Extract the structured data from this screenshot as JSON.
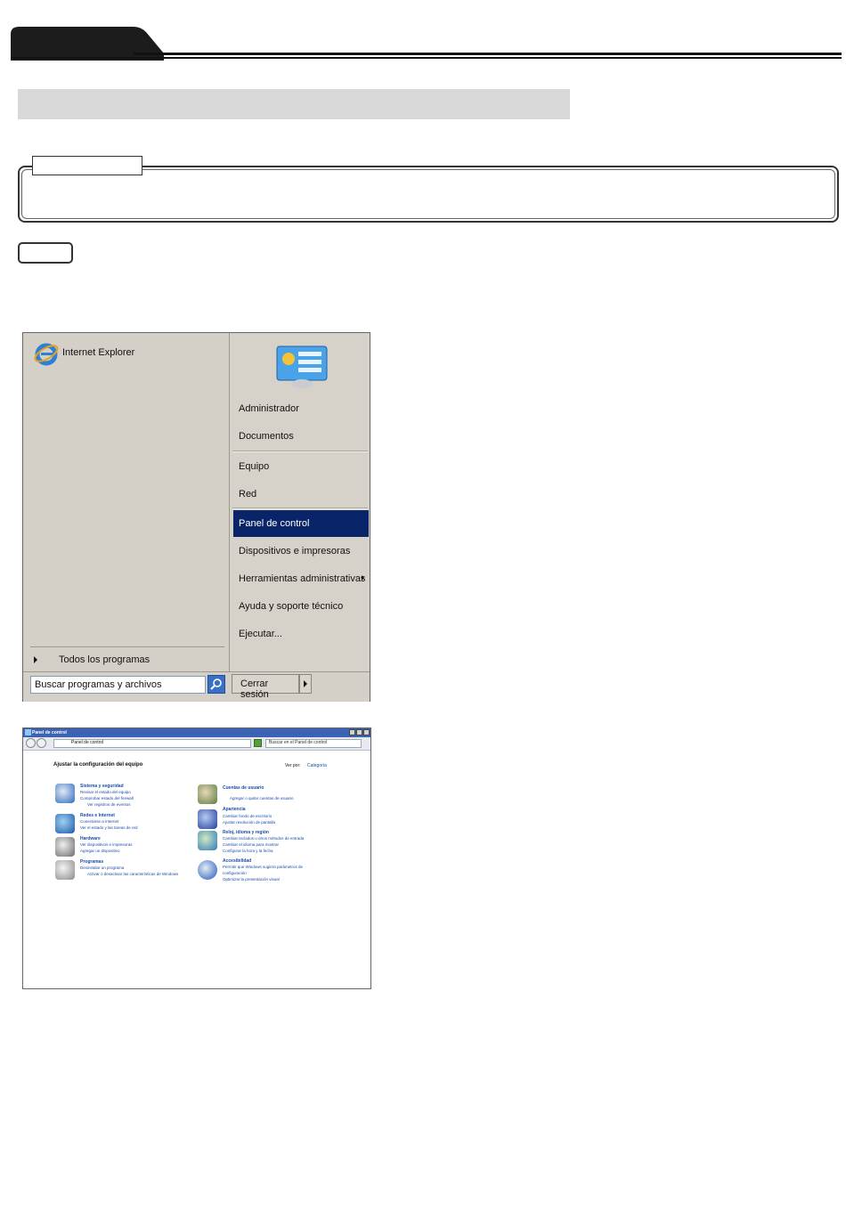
{
  "start_menu": {
    "pinned": [
      {
        "label": "Internet Explorer",
        "icon": "internet-explorer-icon"
      }
    ],
    "right_items": [
      {
        "label": "Administrador"
      },
      {
        "label": "Documentos"
      },
      {
        "label": "Equipo"
      },
      {
        "label": "Red"
      },
      {
        "label": "Panel de control",
        "selected": true
      },
      {
        "label": "Dispositivos e impresoras"
      },
      {
        "label": "Herramientas administrativas",
        "has_submenu": true
      },
      {
        "label": "Ayuda y soporte técnico"
      },
      {
        "label": "Ejecutar..."
      }
    ],
    "all_programs": "Todos los programas",
    "search_placeholder": "Buscar programas y archivos",
    "logoff": "Cerrar sesión",
    "colors": {
      "selected_bg": "#0a246a",
      "menu_bg": "#d4d0c8"
    }
  },
  "control_panel": {
    "window_title": "Panel de control",
    "address": "Panel de control",
    "search_placeholder": "Buscar en el Panel de control",
    "heading": "Ajustar la configuración del equipo",
    "view_by_label": "Ver por:",
    "view_by_value": "Categoría",
    "categories": [
      {
        "title": "Sistema y seguridad",
        "icon": "shield-icon",
        "links": [
          "Revisar el estado del equipo",
          "Comprobar estado del firewall",
          "Ver registros de eventos"
        ]
      },
      {
        "title": "Redes e Internet",
        "icon": "network-icon",
        "links": [
          "Conectarse a Internet",
          "Ver el estado y las tareas de red"
        ]
      },
      {
        "title": "Hardware",
        "icon": "printer-icon",
        "links": [
          "Ver dispositivos e impresoras",
          "Agregar un dispositivo"
        ]
      },
      {
        "title": "Programas",
        "icon": "programs-icon",
        "links": [
          "Desinstalar un programa",
          "Activar o desactivar las características de Windows"
        ]
      },
      {
        "title": "Cuentas de usuario",
        "icon": "users-icon",
        "links": [
          "Agregar o quitar cuentas de usuario"
        ]
      },
      {
        "title": "Apariencia",
        "icon": "appearance-icon",
        "links": [
          "Cambiar fondo de escritorio",
          "Ajustar resolución de pantalla"
        ]
      },
      {
        "title": "Reloj, idioma y región",
        "icon": "globe-clock-icon",
        "links": [
          "Cambiar teclados u otros métodos de entrada",
          "Cambiar el idioma para mostrar",
          "Configurar la hora y la fecha"
        ]
      },
      {
        "title": "Accesibilidad",
        "icon": "accessibility-icon",
        "links": [
          "Permitir que Windows sugiera parámetros de",
          "configuración",
          "Optimizar la presentación visual"
        ]
      }
    ]
  }
}
